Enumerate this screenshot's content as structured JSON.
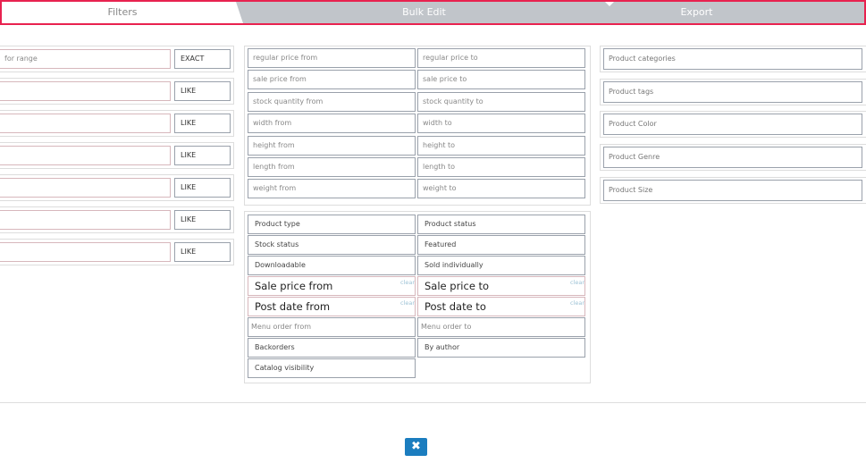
{
  "tabs": {
    "filters": "Filters",
    "bulk_edit": "Bulk Edit",
    "export": "Export"
  },
  "left_rows": [
    {
      "value": "for range",
      "mode": "EXACT"
    },
    {
      "value": "",
      "mode": "LIKE"
    },
    {
      "value": "",
      "mode": "LIKE"
    },
    {
      "value": "",
      "mode": "LIKE"
    },
    {
      "value": "",
      "mode": "LIKE"
    },
    {
      "value": "",
      "mode": "LIKE"
    },
    {
      "value": "",
      "mode": "LIKE"
    }
  ],
  "range_fields": [
    [
      "regular price from",
      "regular price to"
    ],
    [
      "sale price from",
      "sale price to"
    ],
    [
      "stock quantity from",
      "stock quantity to"
    ],
    [
      "width from",
      "width to"
    ],
    [
      "height from",
      "height to"
    ],
    [
      "length from",
      "length to"
    ],
    [
      "weight from",
      "weight to"
    ]
  ],
  "select_fields": {
    "product_type": "Product type",
    "product_status": "Product status",
    "stock_status": "Stock status",
    "featured": "Featured",
    "downloadable": "Downloadable",
    "sold_individually": "Sold individually",
    "sale_price_from": "Sale price from",
    "sale_price_to": "Sale price to",
    "post_date_from": "Post date from",
    "post_date_to": "Post date to",
    "menu_order_from": "Menu order from",
    "menu_order_to": "Menu order to",
    "backorders": "Backorders",
    "by_author": "By author",
    "catalog_visibility": "Catalog visibility",
    "clear": "clear"
  },
  "taxonomies": [
    "Product categories",
    "Product tags",
    "Product Color",
    "Product Genre",
    "Product Size"
  ],
  "close_icon": "close-icon",
  "colors": {
    "accent": "#e8224f",
    "button": "#1b7dbf",
    "tab_inactive": "#c1c5ca"
  }
}
